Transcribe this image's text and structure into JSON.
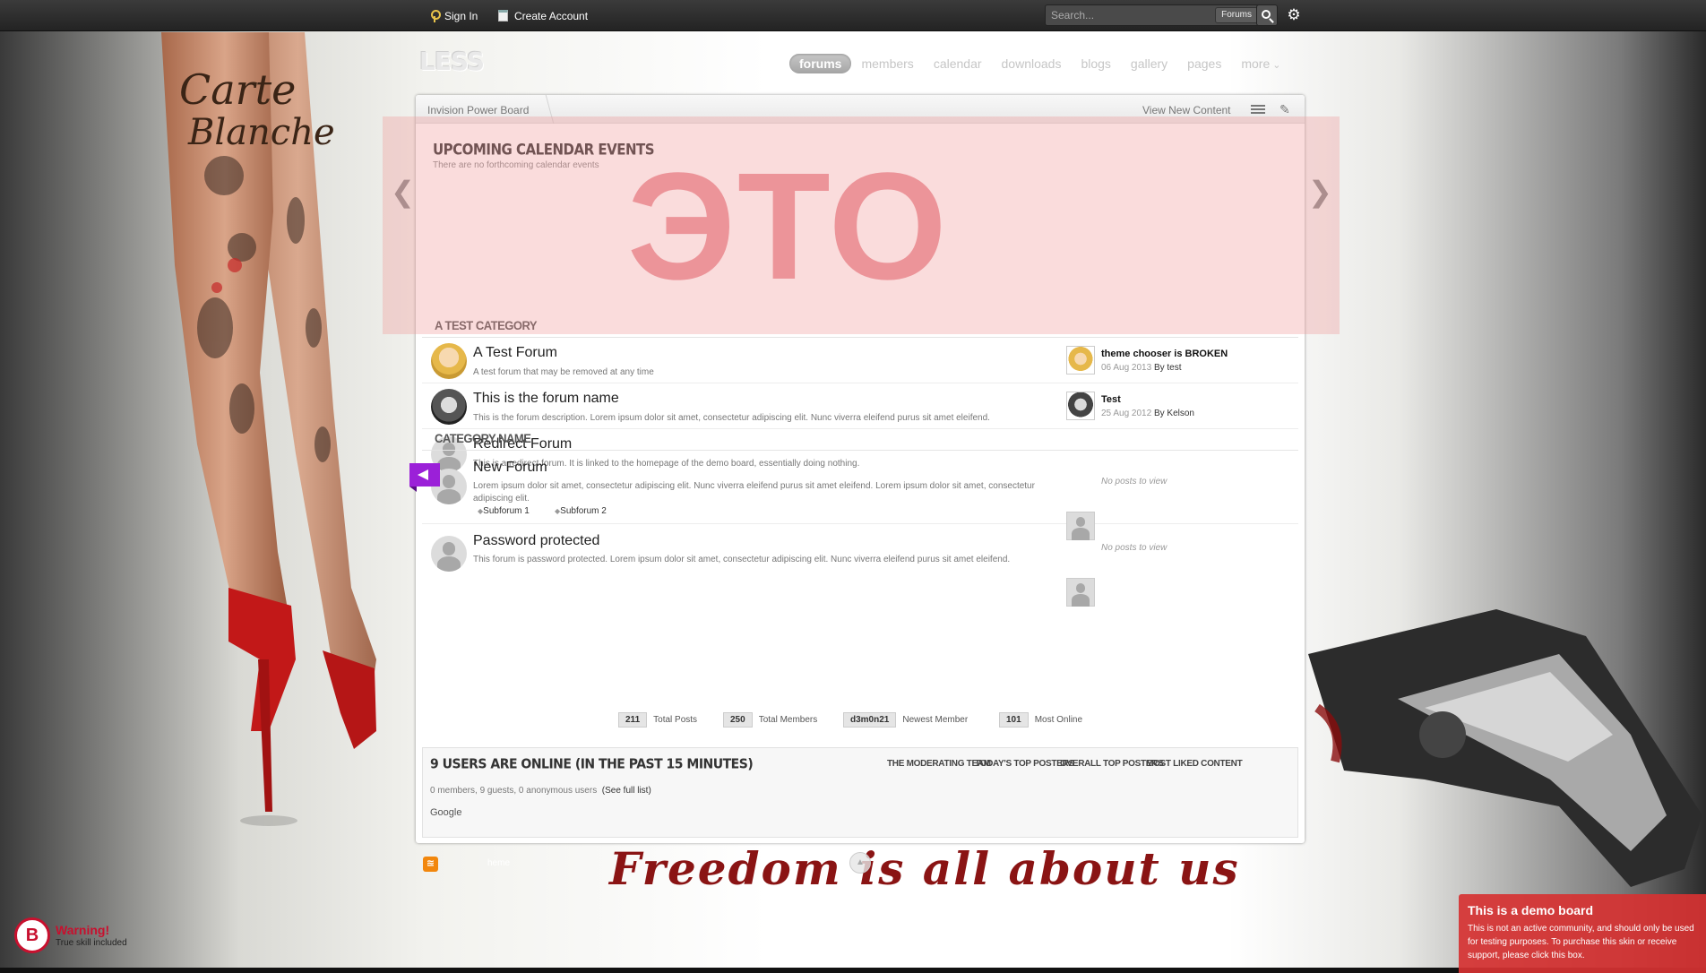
{
  "topbar": {
    "signin_label": "Sign In",
    "create_account_label": "Create Account",
    "search_placeholder": "Search...",
    "search_scope": "Forums"
  },
  "logo": "LESS",
  "nav": [
    {
      "label": "forums",
      "active": true
    },
    {
      "label": "members"
    },
    {
      "label": "calendar"
    },
    {
      "label": "downloads"
    },
    {
      "label": "blogs"
    },
    {
      "label": "gallery"
    },
    {
      "label": "pages"
    },
    {
      "label": "more"
    }
  ],
  "breadcrumb": {
    "home": "Invision Power Board",
    "view_new": "View New Content"
  },
  "calendar": {
    "title": "UPCOMING CALENDAR EVENTS",
    "subtitle": "There are no forthcoming calendar events"
  },
  "overlay_text": "ЭТО",
  "categories": [
    {
      "title": "A TEST CATEGORY",
      "forums": [
        {
          "title": "A Test Forum",
          "desc": "A test forum that may be removed at any time",
          "last_post": {
            "title": "theme chooser is BROKEN",
            "date": "06 Aug 2013",
            "by": "By",
            "author": "test"
          }
        },
        {
          "title": "This is the forum name",
          "desc": "This is the forum description. Lorem ipsum dolor sit amet, consectetur adipiscing elit. Nunc viverra eleifend purus sit amet eleifend.",
          "last_post": {
            "title": "Test",
            "date": "25 Aug 2012",
            "by": "By",
            "author": "Kelson"
          }
        },
        {
          "title": "Redirect Forum",
          "desc": "This is a redirect forum. It is linked to the homepage of the demo board, essentially doing nothing."
        }
      ]
    },
    {
      "title": "CATEGORY NAME",
      "forums": [
        {
          "title": "New Forum",
          "desc": "Lorem ipsum dolor sit amet, consectetur adipiscing elit. Nunc viverra eleifend purus sit amet eleifend. Lorem ipsum dolor sit amet, consectetur adipiscing elit.",
          "subforums": [
            "Subforum 1",
            "Subforum 2"
          ],
          "no_posts": "No posts to view"
        },
        {
          "title": "Password protected",
          "desc": "This forum is password protected. Lorem ipsum dolor sit amet, consectetur adipiscing elit. Nunc viverra eleifend purus sit amet eleifend.",
          "no_posts": "No posts to view"
        }
      ]
    }
  ],
  "stats": [
    {
      "num": "211",
      "label": "Total Posts"
    },
    {
      "num": "250",
      "label": "Total Members"
    },
    {
      "num": "d3m0n21",
      "label": "Newest Member"
    },
    {
      "num": "101",
      "label": "Most Online"
    }
  ],
  "online": {
    "title": "9 USERS ARE ONLINE (IN THE PAST 15 MINUTES)",
    "links": [
      "THE MODERATING TEAM",
      "TODAY'S TOP POSTERS",
      "OVERALL TOP POSTERS",
      "MOST LIKED CONTENT"
    ],
    "counts": "0 members, 9 guests, 0 anonymous users",
    "see_full": "(See full list)",
    "bot": "Google"
  },
  "footer": {
    "theme_label": "heme",
    "banner": "Freedom is all about us"
  },
  "warning": {
    "logo_letter": "B",
    "title": "Warning!",
    "sub": "True skill included"
  },
  "demo": {
    "title": "This is a demo board",
    "body": "This is not an active community, and should only be used for testing purposes. To purchase this skin or receive support, please click this box."
  },
  "background_art": {
    "tattoo_text_1": "Carte",
    "tattoo_text_2": "Blanche"
  },
  "colors": {
    "accent": "#c8102e",
    "demo_bg": "#d63232",
    "overlay": "#f09696"
  }
}
